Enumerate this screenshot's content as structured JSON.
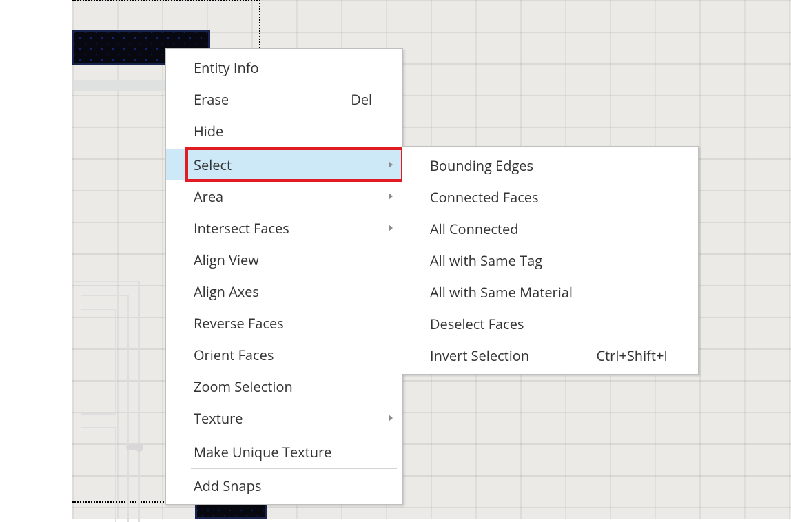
{
  "context_menu": {
    "items": [
      {
        "label": "Entity Info",
        "shortcut": "",
        "submenu": false
      },
      {
        "label": "Erase",
        "shortcut": "Del",
        "submenu": false
      },
      {
        "label": "Hide",
        "shortcut": "",
        "submenu": false
      },
      {
        "separator": true
      },
      {
        "label": "Select",
        "shortcut": "",
        "submenu": true,
        "highlighted": true
      },
      {
        "label": "Area",
        "shortcut": "",
        "submenu": true
      },
      {
        "label": "Intersect Faces",
        "shortcut": "",
        "submenu": true
      },
      {
        "label": "Align View",
        "shortcut": "",
        "submenu": false
      },
      {
        "label": "Align Axes",
        "shortcut": "",
        "submenu": false
      },
      {
        "label": "Reverse Faces",
        "shortcut": "",
        "submenu": false
      },
      {
        "label": "Orient Faces",
        "shortcut": "",
        "submenu": false
      },
      {
        "label": "Zoom Selection",
        "shortcut": "",
        "submenu": false
      },
      {
        "label": "Texture",
        "shortcut": "",
        "submenu": true
      },
      {
        "separator": true
      },
      {
        "label": "Make Unique Texture",
        "shortcut": "",
        "submenu": false
      },
      {
        "separator": true
      },
      {
        "label": "Add Snaps",
        "shortcut": "",
        "submenu": false
      }
    ]
  },
  "select_submenu": {
    "items": [
      {
        "label": "Bounding Edges",
        "shortcut": ""
      },
      {
        "label": "Connected Faces",
        "shortcut": ""
      },
      {
        "label": "All Connected",
        "shortcut": ""
      },
      {
        "label": "All with Same Tag",
        "shortcut": ""
      },
      {
        "label": "All with Same Material",
        "shortcut": ""
      },
      {
        "label": "Deselect Faces",
        "shortcut": ""
      },
      {
        "label": "Invert Selection",
        "shortcut": "Ctrl+Shift+I"
      }
    ]
  }
}
